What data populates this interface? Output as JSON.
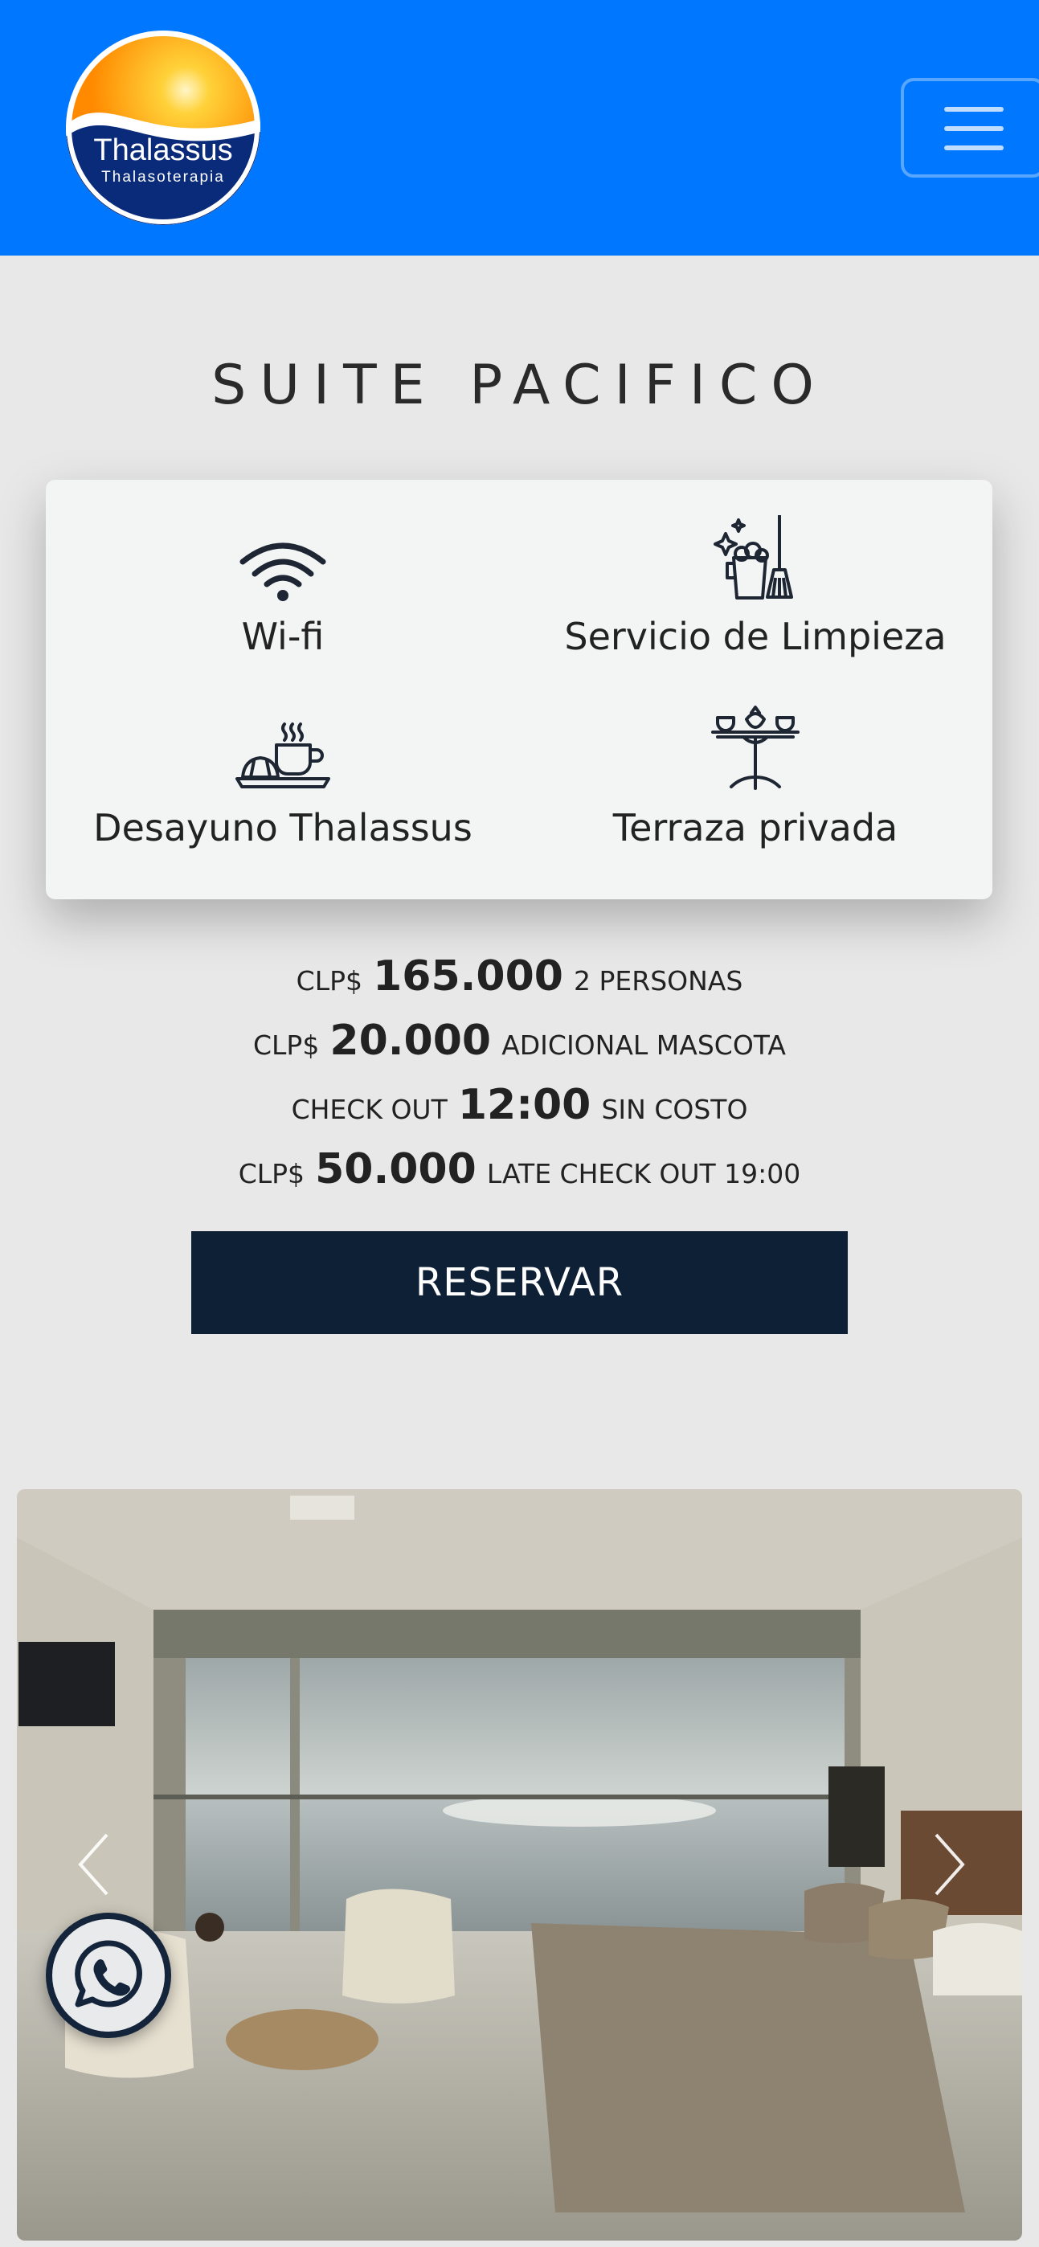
{
  "header": {
    "logo_title": "Thalassus",
    "logo_subtitle": "Thalasoterapia",
    "brand_color": "#0077ff",
    "menu_icon": "hamburger-icon"
  },
  "page_title": "SUITE PACIFICO",
  "amenities": [
    {
      "label": "Wi-fi",
      "icon": "wifi-icon"
    },
    {
      "label": "Servicio de Limpieza",
      "icon": "cleaning-icon"
    },
    {
      "label": "Desayuno Thalassus",
      "icon": "breakfast-icon"
    },
    {
      "label": "Terraza privada",
      "icon": "terrace-table-icon"
    }
  ],
  "prices": [
    {
      "prefix": "CLP$",
      "value": "165.000",
      "suffix": "2 PERSONAS"
    },
    {
      "prefix": "CLP$",
      "value": "20.000",
      "suffix": "ADICIONAL MASCOTA"
    },
    {
      "prefix": "CHECK OUT",
      "value": "12:00",
      "suffix": "SIN COSTO"
    },
    {
      "prefix": "CLP$",
      "value": "50.000",
      "suffix": "LATE CHECK OUT 19:00"
    }
  ],
  "reserve_label": "RESERVAR",
  "carousel": {
    "prev_icon": "chevron-left-icon",
    "next_icon": "chevron-right-icon"
  },
  "whatsapp_icon": "whatsapp-icon",
  "colors": {
    "button_dark": "#0e2036",
    "card_bg": "#f3f4f4",
    "page_bg": "#e8e8e8"
  }
}
